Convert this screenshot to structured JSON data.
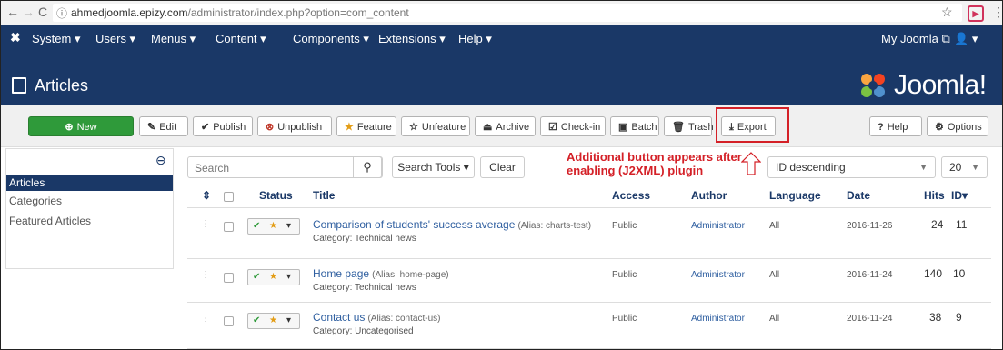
{
  "browser": {
    "url_host": "ahmedjoomla.epizy.com",
    "url_path": "/administrator/index.php?option=com_content"
  },
  "nav": {
    "items": [
      "System ▾",
      "Users ▾",
      "Menus ▾",
      "Content ▾",
      "Components ▾",
      "Extensions ▾",
      "Help ▾"
    ],
    "site_link": "My Joomla",
    "user_menu": "▾"
  },
  "page": {
    "title": "Articles",
    "brand": "Joomla!"
  },
  "toolbar": {
    "new": "New",
    "edit": "Edit",
    "publish": "Publish",
    "unpublish": "Unpublish",
    "feature": "Feature",
    "unfeature": "Unfeature",
    "archive": "Archive",
    "checkin": "Check-in",
    "batch": "Batch",
    "trash": "Trash",
    "export": "Export",
    "help": "Help",
    "options": "Options"
  },
  "sidebar": {
    "items": [
      "Articles",
      "Categories",
      "Featured Articles"
    ]
  },
  "filters": {
    "search_placeholder": "Search",
    "search_tools": "Search Tools ▾",
    "clear": "Clear",
    "ordering": "ID descending",
    "limit": "20"
  },
  "annotation": {
    "line1": "Additional button appears after",
    "line2": "enabling (J2XML) plugin"
  },
  "table": {
    "headers": {
      "status": "Status",
      "title": "Title",
      "access": "Access",
      "author": "Author",
      "language": "Language",
      "date": "Date",
      "hits": "Hits",
      "id": "ID"
    },
    "rows": [
      {
        "title": "Comparison of students' success average",
        "alias": "(Alias: charts-test)",
        "category": "Category: Technical news",
        "access": "Public",
        "author": "Administrator",
        "language": "All",
        "date": "2016-11-26",
        "hits": "24",
        "id": "11"
      },
      {
        "title": "Home page",
        "alias": "(Alias: home-page)",
        "category": "Category: Technical news",
        "access": "Public",
        "author": "Administrator",
        "language": "All",
        "date": "2016-11-24",
        "hits": "140",
        "id": "10"
      },
      {
        "title": "Contact us",
        "alias": "(Alias: contact-us)",
        "category": "Category: Uncategorised",
        "access": "Public",
        "author": "Administrator",
        "language": "All",
        "date": "2016-11-24",
        "hits": "38",
        "id": "9"
      }
    ]
  }
}
